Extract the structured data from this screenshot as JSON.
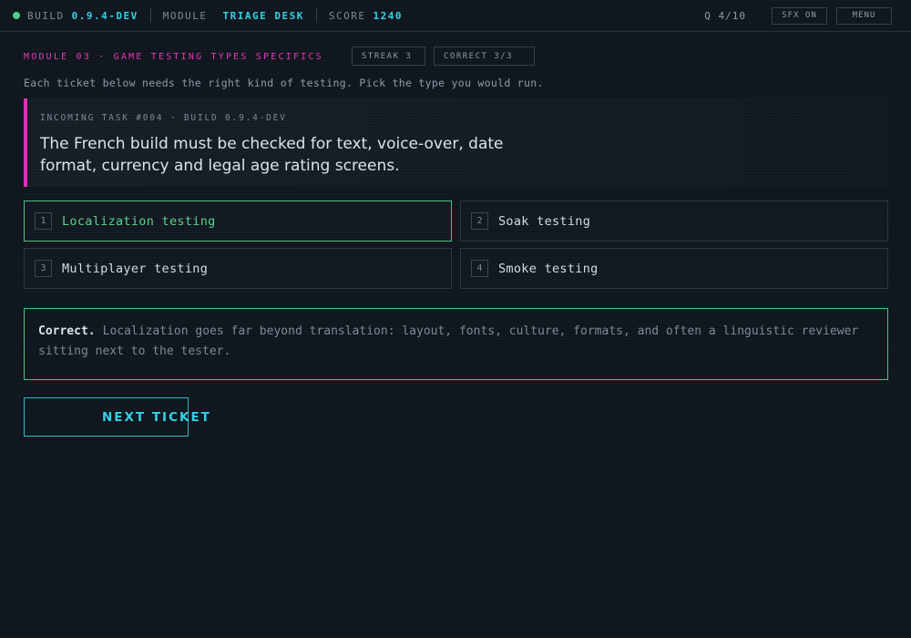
{
  "topbar": {
    "build_label": "BUILD",
    "build_value": "0.9.4-DEV",
    "module_label": "MODULE",
    "module_value": "TRIAGE DESK",
    "score_label": "SCORE",
    "score_value": "1240",
    "question_count": "Q 4/10",
    "sfx_label": "SFX ON",
    "menu_label": "MENU",
    "status_color": "#4fd08a"
  },
  "module": {
    "heading": "MODULE 03 · GAME TESTING TYPES SPECIFICS",
    "streak": "STREAK 3",
    "correct": "CORRECT 3/3",
    "intro": "Each ticket below needs the right kind of testing. Pick the type you would run."
  },
  "ticket": {
    "meta": "INCOMING TASK #004 · BUILD 0.9.4-DEV",
    "text": "The French build must be checked for text, voice-over, date format, currency and legal age rating screens."
  },
  "options": [
    {
      "num": "1",
      "label": "Localization testing",
      "state": "correct"
    },
    {
      "num": "2",
      "label": "Soak testing",
      "state": "default"
    },
    {
      "num": "3",
      "label": "Multiplayer testing",
      "state": "default"
    },
    {
      "num": "4",
      "label": "Smoke testing",
      "state": "default"
    }
  ],
  "feedback": {
    "title": "Correct.",
    "body": "Localization goes far beyond translation: layout, fonts, culture, formats, and often a linguistic reviewer sitting next to the tester."
  },
  "next_button": "NEXT TICKET",
  "colors": {
    "accent": "#35d0e6",
    "magenta": "#e838b8",
    "success": "#4fc07e",
    "background": "#0f161e"
  }
}
